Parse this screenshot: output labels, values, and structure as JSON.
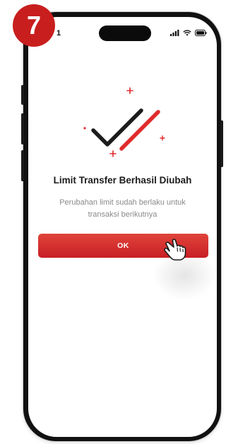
{
  "tutorial": {
    "step_number": "7"
  },
  "status_bar": {
    "time": "1",
    "icons": [
      "cellular-signal-icon",
      "wifi-icon",
      "battery-icon"
    ]
  },
  "dialog": {
    "illustration_icon": "checkmark-success-icon",
    "title": "Limit Transfer Berhasil Diubah",
    "message": "Perubahan limit sudah berlaku untuk transaksi berikutnya",
    "ok_button_label": "OK"
  },
  "cursor": {
    "icon": "hand-pointer-icon"
  },
  "colors": {
    "accent": "#c81e1e",
    "button_gradient_top": "#e0443a",
    "button_gradient_bottom": "#c81f26",
    "check_dark": "#1c1c1c",
    "check_red": "#e02b2b"
  }
}
